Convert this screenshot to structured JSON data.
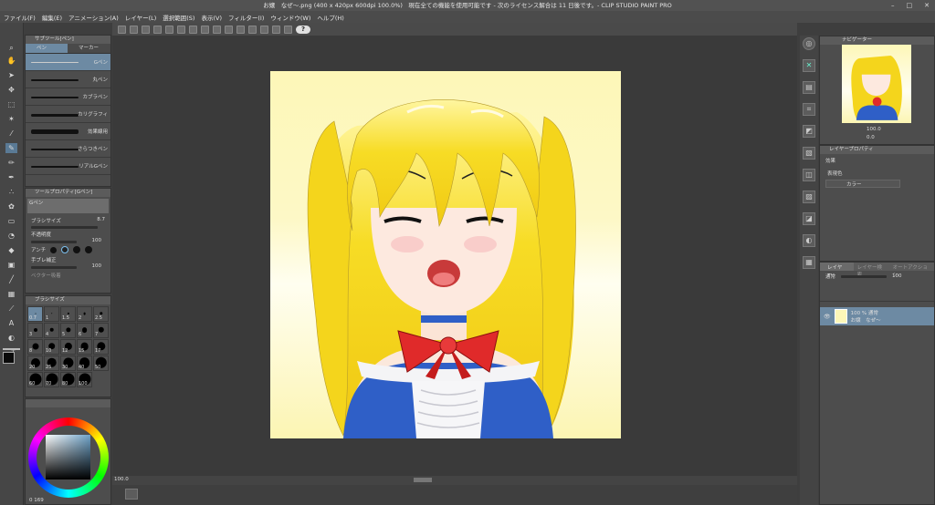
{
  "titlebar": {
    "text": "お嬢　なぜ～.png (400 x 420px 600dpi 100.0%)　現在全ての機能を使用可能です - 次のライセンス解合は 11 日後です。- CLIP STUDIO PAINT PRO",
    "minimize": "–",
    "maximize": "□",
    "close": "✕"
  },
  "menu": [
    "ファイル(F)",
    "編集(E)",
    "アニメーション(A)",
    "レイヤー(L)",
    "選択範囲(S)",
    "表示(V)",
    "フィルター(I)",
    "ウィンドウ(W)",
    "ヘルプ(H)"
  ],
  "command_bar": {
    "help": "?"
  },
  "sub_tool_panel": {
    "title": "サブツール[ペン]",
    "tabs": [
      "ペン",
      "マーカー"
    ],
    "brushes": [
      "Gペン",
      "丸ペン",
      "カブラペン",
      "カリグラフィ",
      "効果線用",
      "さらつきペン",
      "リアルGペン"
    ]
  },
  "tool_property": {
    "title": "ツールプロパティ[Gペン]",
    "current": "Gペン",
    "brush_size_label": "ブラシサイズ",
    "brush_size": "8.7",
    "opacity_label": "不透明度",
    "opacity": "100",
    "antialias_label": "アンチ",
    "stabilization_label": "手ブレ補正",
    "stabilization": "100",
    "vector_label": "ベクター吸着"
  },
  "brush_size_panel": {
    "title": "ブラシサイズ",
    "sizes": [
      "0.7",
      "1",
      "1.5",
      "2",
      "2.5",
      "3",
      "4",
      "5",
      "6",
      "7",
      "8",
      "10",
      "12",
      "15",
      "17",
      "20",
      "25",
      "30",
      "40",
      "50",
      "60",
      "70",
      "80",
      "100"
    ]
  },
  "color_panel": {
    "main_color": "#0a0a0a",
    "sub_color": "#ffffff",
    "bottom_readout": "0 169"
  },
  "navigator": {
    "title": "ナビゲーター",
    "zoom": "100.0",
    "rotation": "0.0"
  },
  "layer_property": {
    "title": "レイヤープロパティ",
    "effect_label": "効果",
    "expression_color_label": "表現色",
    "expression_color_value": "カラー"
  },
  "layer_panel": {
    "tabs": [
      "レイヤー",
      "レイヤー検索",
      "オートアクション"
    ],
    "blend_mode": "通常",
    "opacity_value": "100",
    "layers": [
      {
        "title": "100 % 通常",
        "name": "お嬢　なぜ～"
      }
    ]
  },
  "status": {
    "zoom_left": "100.0",
    "zoom_nav": "100.0",
    "angle_nav": "0.0"
  },
  "colors": {
    "accent": "#5a7a95",
    "canvas_bg": "#3a3a3a"
  }
}
